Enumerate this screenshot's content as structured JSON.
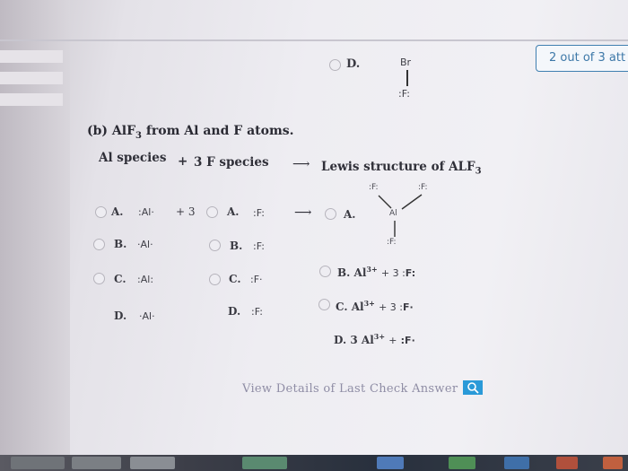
{
  "status": {
    "attempts": "2 out of 3 att"
  },
  "prev_question": {
    "option_d_label": "D.",
    "option_d_top_atom": "Br",
    "option_d_bottom_atom": "F"
  },
  "part_b": {
    "heading_main": "(b) AlF",
    "heading_sub": "3",
    "heading_rest": " from Al and F atoms.",
    "col_al_header": "Al species",
    "col_plus": "+",
    "col_f_header": "3 F species",
    "arrow": "⟶",
    "col_lewis_header": "Lewis structure of ALF",
    "col_lewis_sub": "3"
  },
  "al_options": [
    {
      "label": "A.",
      "sym": "Al"
    },
    {
      "label": "B.",
      "sym": "Al"
    },
    {
      "label": "C.",
      "sym": "Al"
    },
    {
      "label": "D.",
      "sym": "Al"
    }
  ],
  "a_row": {
    "plus_three": "+ 3"
  },
  "f_options": [
    {
      "label": "A.",
      "sym": "F"
    },
    {
      "label": "B.",
      "sym": "F"
    },
    {
      "label": "C.",
      "sym": "F"
    },
    {
      "label": "D.",
      "sym": "F"
    }
  ],
  "lewis_options": {
    "a_label": "A.",
    "a_atoms": {
      "center": "Al",
      "left": "F",
      "right": "F",
      "bottom": "F"
    },
    "b": {
      "label": "B.",
      "al": "Al",
      "charge": "3+",
      "rest": "+ 3 :",
      "f": "F"
    },
    "c": {
      "label": "C.",
      "al": "Al",
      "charge": "3+",
      "rest": "+ 3 :",
      "f": "F"
    },
    "d": {
      "label": "D.",
      "coef": "3",
      "al": "Al",
      "charge": "3+",
      "rest": "+",
      "f": "F"
    }
  },
  "footer": {
    "view_details": "View Details of Last Check Answer"
  }
}
